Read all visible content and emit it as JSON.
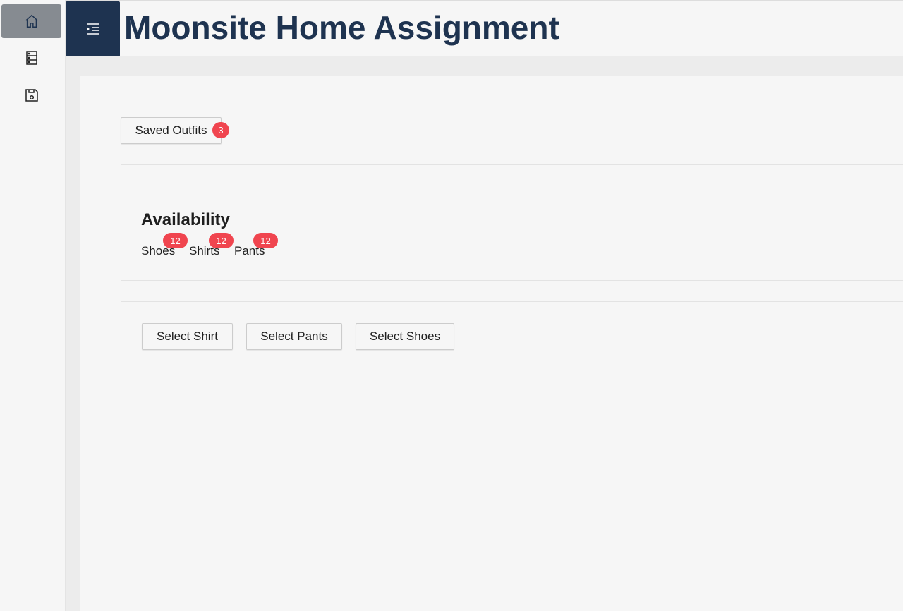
{
  "header": {
    "title": "Moonsite Home Assignment"
  },
  "sidebar": {
    "items": [
      {
        "icon": "home-icon"
      },
      {
        "icon": "list-icon"
      },
      {
        "icon": "save-icon"
      }
    ]
  },
  "saved_outfits": {
    "label": "Saved Outfits",
    "count": "3"
  },
  "availability": {
    "title": "Availability",
    "items": [
      {
        "label": "Shoes",
        "count": "12"
      },
      {
        "label": "Shirts",
        "count": "12"
      },
      {
        "label": "Pants",
        "count": "12"
      }
    ]
  },
  "actions": {
    "select_shirt": "Select Shirt",
    "select_pants": "Select Pants",
    "select_shoes": "Select Shoes"
  },
  "colors": {
    "primary": "#1e3350",
    "badge": "#f0454f"
  }
}
